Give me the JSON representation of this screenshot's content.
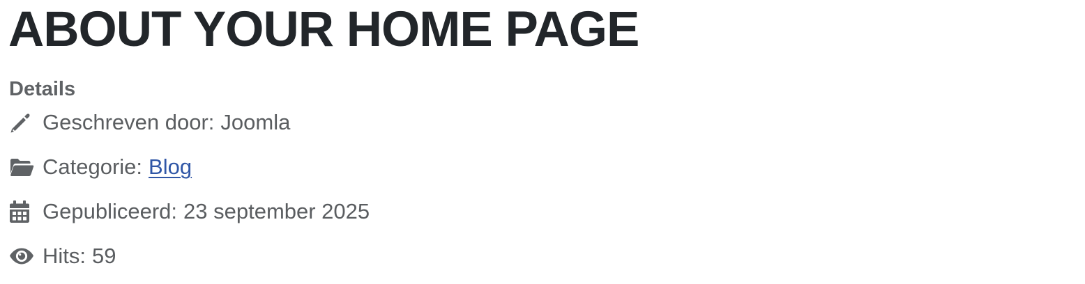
{
  "article": {
    "title": "ABOUT YOUR HOME PAGE"
  },
  "details": {
    "heading": "Details",
    "author": {
      "label": "Geschreven door:",
      "value": "Joomla",
      "icon": "pencil-icon"
    },
    "category": {
      "label": "Categorie:",
      "value": "Blog",
      "icon": "folder-open-icon"
    },
    "published": {
      "label": "Gepubliceerd:",
      "value": "23 september 2025",
      "icon": "calendar-icon"
    },
    "hits": {
      "label": "Hits:",
      "value": "59",
      "icon": "eye-icon"
    }
  },
  "colors": {
    "title": "#22262a",
    "detail_text": "#5a5d60",
    "link": "#2f56a6",
    "icons": "#5f6265",
    "background": "#ffffff"
  }
}
